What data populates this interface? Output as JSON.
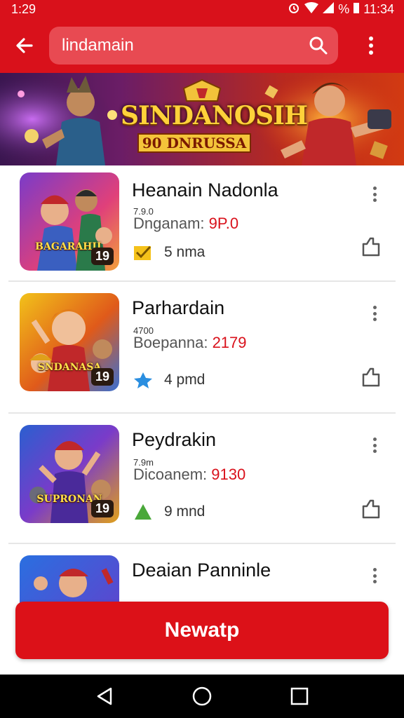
{
  "status_bar": {
    "time_left": "1:29",
    "battery": "%",
    "time_right": "11:34"
  },
  "app_bar": {
    "back_icon": "arrow-left-icon",
    "search_value": "lindamain",
    "search_icon": "search-icon",
    "more_icon": "more-vertical-icon"
  },
  "banner": {
    "title": "SINDANOSIH",
    "subtitle": "90 DNRUSSA"
  },
  "items": [
    {
      "title": "Heanain Nadonla",
      "small": "7.9.0",
      "sub_label": "Dnganam:",
      "sub_value": "9P.0",
      "meta": "5 nma",
      "badge": "19",
      "thumb_label": "BAGARAHIL",
      "meta_icon": "check-badge-icon"
    },
    {
      "title": "Parhardain",
      "small": "4700",
      "sub_label": "Boepanna:",
      "sub_value": "2179",
      "meta": "4 pmd",
      "badge": "19",
      "thumb_label": "SNDANASA",
      "meta_icon": "star-badge-icon"
    },
    {
      "title": "Peydrakin",
      "small": "7.9m",
      "sub_label": "Dicoanem:",
      "sub_value": "9130",
      "meta": "9 mnd",
      "badge": "19",
      "thumb_label": "SUPRONAN",
      "meta_icon": "tree-badge-icon"
    },
    {
      "title": "Deaian Panninle",
      "small": "",
      "sub_label": "",
      "sub_value": "",
      "meta": "",
      "badge": "",
      "thumb_label": "",
      "meta_icon": ""
    }
  ],
  "cta": {
    "label": "Newatp"
  },
  "nav": {
    "back": "nav-back-icon",
    "home": "nav-home-icon",
    "recents": "nav-recents-icon"
  },
  "colors": {
    "primary": "#d9111b",
    "accent_price": "#d9111b"
  }
}
